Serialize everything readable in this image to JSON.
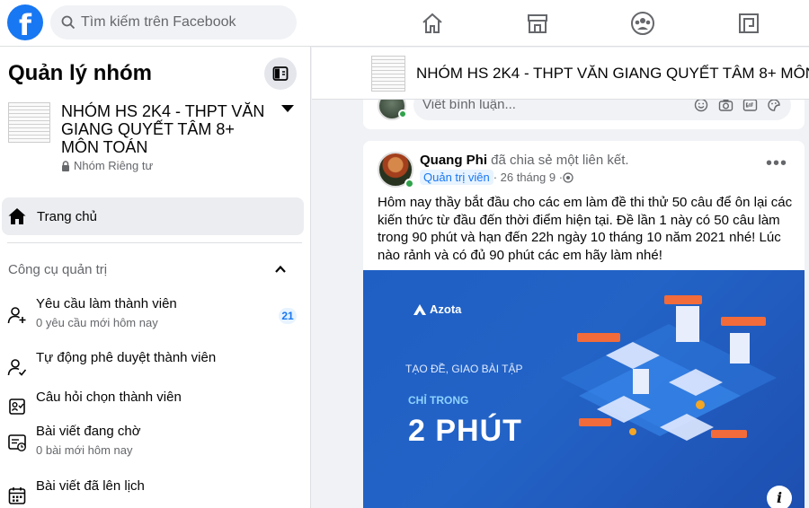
{
  "topbar": {
    "logo": "f",
    "search_placeholder": "Tìm kiếm trên Facebook",
    "nav_icons": [
      "home-icon",
      "marketplace-icon",
      "groups-icon",
      "gaming-icon"
    ]
  },
  "sidebar": {
    "title": "Quản lý nhóm",
    "group": {
      "name": "NHÓM HS 2K4 - THPT VĂN GIANG QUYẾT TÂM 8+ MÔN TOÁN",
      "privacy": "Nhóm Riêng tư"
    },
    "home_label": "Trang chủ",
    "section_title": "Công cụ quản trị",
    "items": [
      {
        "label": "Yêu cầu làm thành viên",
        "sub": "0 yêu cầu mới hôm nay",
        "badge": "21"
      },
      {
        "label": "Tự động phê duyệt thành viên"
      },
      {
        "label": "Câu hỏi chọn thành viên"
      },
      {
        "label": "Bài viết đang chờ",
        "sub": "0 bài mới hôm nay"
      },
      {
        "label": "Bài viết đã lên lịch"
      }
    ]
  },
  "main": {
    "header_title": "NHÓM HS 2K4 - THPT VĂN GIANG QUYẾT TÂM 8+ MÔN...",
    "comment_placeholder": "Viết bình luận...",
    "post": {
      "author": "Quang Phi",
      "action": " đã chia sẻ một liên kết.",
      "role": "Quản trị viên",
      "date": " · 26 tháng 9 · ",
      "more": "•••",
      "text": "Hôm nay thầy bắt đầu cho các em làm đề thi thử 50 câu để ôn lại các kiến thức từ đầu đến thời điểm hiện tại. Đề lần 1 này có 50 câu làm trong 90 phút và hạn đến 22h ngày 10 tháng 10 năm 2021 nhé! Lúc nào rảnh và có đủ 90 phút các em hãy làm nhé!",
      "image": {
        "brand": "Azota",
        "line1": "TẠO ĐỀ, GIAO BÀI TẬP",
        "line2": "CHỈ TRONG",
        "line3": "2 PHÚT"
      },
      "info": "i"
    }
  },
  "colors": {
    "brand": "#1877f2",
    "online": "#31a24c",
    "badge_bg": "#e7f3ff"
  }
}
